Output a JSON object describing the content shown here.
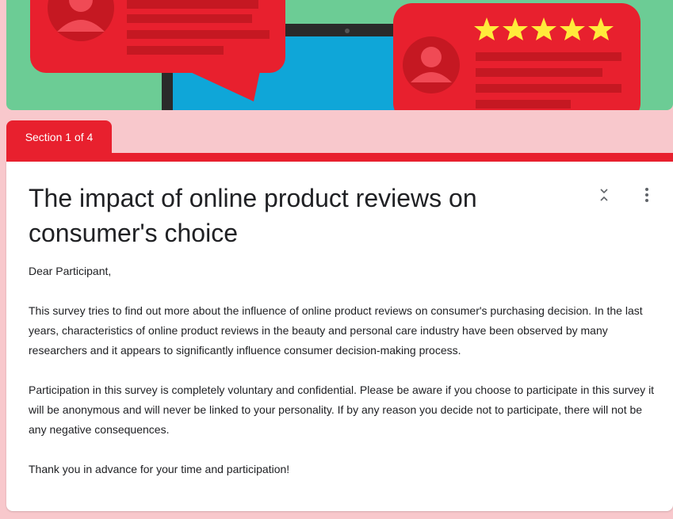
{
  "section": {
    "label": "Section 1 of 4"
  },
  "form": {
    "title": "The impact of online product reviews on consumer's choice",
    "description": [
      "Dear Participant,",
      "This survey tries to find out more about the influence of online product reviews on consumer's purchasing decision. In the last years, characteristics of online product reviews in the beauty and personal care industry have been observed by many researchers and it appears to significantly influence consumer decision-making process.",
      "Participation in this survey is completely voluntary and confidential. Please be aware if you choose to participate in this survey it will be anonymous and will never be linked to your personality. If by any reason you decide not to participate, there will not be any negative consequences.",
      "Thank you in advance for your time and participation!"
    ]
  },
  "icons": {
    "collapse": "collapse-icon",
    "more": "more-vert-icon",
    "stars": "star-icon",
    "avatar": "person-icon"
  },
  "colors": {
    "accent": "#e8202e",
    "page_background": "#f8c8cc",
    "header_green": "#6ccc95",
    "laptop_blue": "#0fa6d8",
    "star_yellow": "#ffeb3b"
  }
}
